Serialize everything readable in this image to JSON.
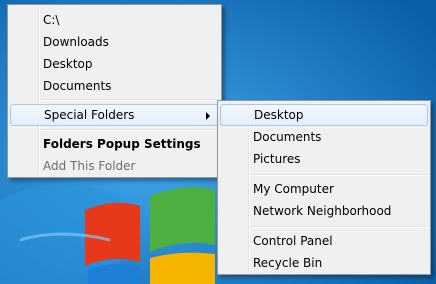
{
  "main_menu": {
    "items": [
      {
        "label": "C:\\"
      },
      {
        "label": "Downloads"
      },
      {
        "label": "Desktop"
      },
      {
        "label": "Documents"
      },
      {
        "label": "Special Folders"
      },
      {
        "label": "Folders Popup Settings"
      },
      {
        "label": "Add This Folder"
      }
    ]
  },
  "submenu": {
    "items": [
      {
        "label": "Desktop"
      },
      {
        "label": "Documents"
      },
      {
        "label": "Pictures"
      },
      {
        "label": "My Computer"
      },
      {
        "label": "Network Neighborhood"
      },
      {
        "label": "Control Panel"
      },
      {
        "label": "Recycle Bin"
      }
    ]
  },
  "icons": {
    "submenu_arrow": "chevron-right-icon",
    "desktop_logo": "windows-logo"
  },
  "colors": {
    "desktop_bg": "#1f7fc9",
    "menu_bg": "#f0f0f0",
    "highlight_border": "#a8c8ec"
  }
}
